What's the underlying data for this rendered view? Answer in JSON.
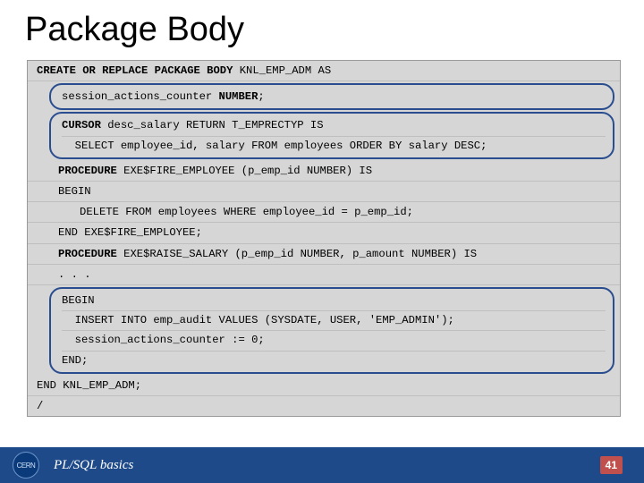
{
  "title": "Package Body",
  "code": {
    "l1": "CREATE OR REPLACE PACKAGE BODY KNL_EMP_ADM AS",
    "hl1_a": "session_actions_counter NUMBER;",
    "hl2_a": "CURSOR desc_salary RETURN T_EMPRECTYP IS",
    "hl2_b": "  SELECT employee_id, salary FROM employees ORDER BY salary DESC;",
    "l_proc1": "PROCEDURE EXE$FIRE_EMPLOYEE (p_emp_id NUMBER) IS",
    "l_begin1": "BEGIN",
    "l_del": "DELETE FROM employees WHERE employee_id = p_emp_id;",
    "l_end1": "END EXE$FIRE_EMPLOYEE;",
    "l_proc2": "PROCEDURE EXE$RAISE_SALARY (p_emp_id NUMBER, p_amount NUMBER) IS",
    "l_dots": ". . .",
    "hl3_a": "BEGIN",
    "hl3_b": "  INSERT INTO emp_audit VALUES (SYSDATE, USER, 'EMP_ADMIN');",
    "hl3_c": "  session_actions_counter := 0;",
    "hl3_d": "END;",
    "l_endpkg": "END KNL_EMP_ADM;",
    "l_slash": "/"
  },
  "footer": {
    "logo_text": "CERN",
    "text": "PL/SQL basics",
    "page": "41"
  }
}
